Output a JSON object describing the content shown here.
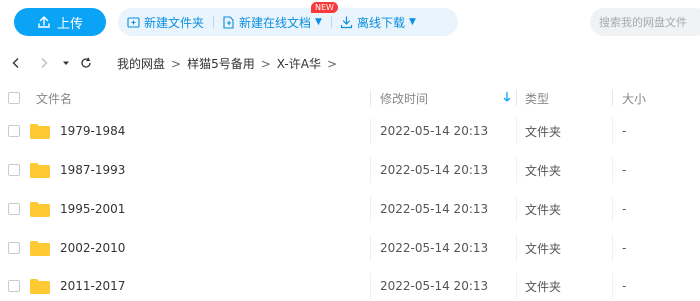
{
  "toolbar": {
    "upload_label": "上传",
    "actions": [
      {
        "label": "新建文件夹",
        "icon": "new-folder-icon"
      },
      {
        "label": "新建在线文档",
        "icon": "new-doc-icon",
        "badge": "NEW"
      },
      {
        "label": "离线下载",
        "icon": "download-icon"
      }
    ],
    "search_placeholder": "搜索我的网盘文件"
  },
  "breadcrumb": [
    "我的网盘",
    "样猫5号备用",
    "X-许A华"
  ],
  "table": {
    "columns": [
      "文件名",
      "修改时间",
      "类型",
      "大小"
    ],
    "rows": [
      {
        "name": "1979-1984",
        "modified": "2022-05-14 20:13",
        "type": "文件夹",
        "size": "-"
      },
      {
        "name": "1987-1993",
        "modified": "2022-05-14 20:13",
        "type": "文件夹",
        "size": "-"
      },
      {
        "name": "1995-2001",
        "modified": "2022-05-14 20:13",
        "type": "文件夹",
        "size": "-"
      },
      {
        "name": "2002-2010",
        "modified": "2022-05-14 20:13",
        "type": "文件夹",
        "size": "-"
      },
      {
        "name": "2011-2017",
        "modified": "2022-05-14 20:13",
        "type": "文件夹",
        "size": "-"
      }
    ]
  },
  "colors": {
    "accent": "#0aa3f5",
    "folder": "#ffc933",
    "badge": "#fa3a3a"
  }
}
